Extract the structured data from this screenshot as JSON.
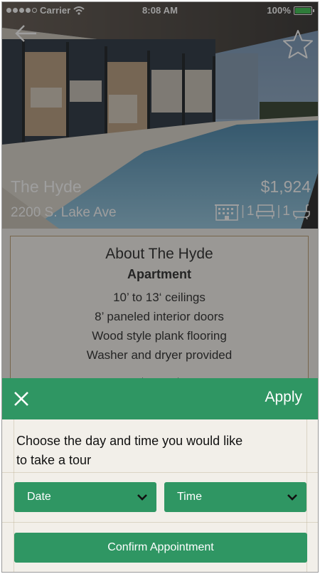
{
  "status_bar": {
    "carrier": "Carrier",
    "time": "8:08 AM",
    "battery": "100%"
  },
  "listing": {
    "name": "The Hyde",
    "address": "2200 S. Lake Ave",
    "price": "$1,924",
    "beds": "1",
    "baths": "1"
  },
  "about": {
    "title": "About The Hyde",
    "type": "Apartment",
    "features": [
      "10’ to 13‘ ceilings",
      "8’ paneled interior doors",
      "Wood style plank flooring",
      "Washer and dryer provided"
    ]
  },
  "tour_sheet": {
    "apply_label": "Apply",
    "prompt": "Choose the day and time you would like to take a tour",
    "date_label": "Date",
    "time_label": "Time",
    "confirm_label": "Confirm Appointment"
  },
  "colors": {
    "accent_green": "#2f9663",
    "background": "#f2efe9",
    "battery_green": "#33c24a"
  },
  "icons": [
    "back-arrow-icon",
    "star-icon",
    "building-icon",
    "bed-icon",
    "bathtub-icon",
    "close-icon",
    "chevron-down-icon",
    "wifi-icon",
    "battery-icon"
  ]
}
